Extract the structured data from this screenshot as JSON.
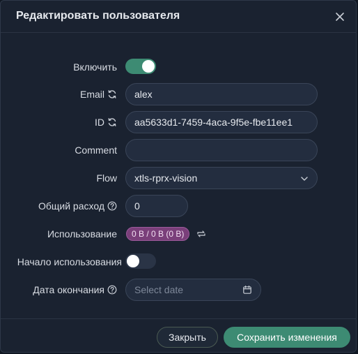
{
  "dialog": {
    "title": "Редактировать пользователя"
  },
  "form": {
    "enable_label": "Включить",
    "enable_on": true,
    "email_label": "Email",
    "email_value": "alex",
    "id_label": "ID",
    "id_value": "aa5633d1-7459-4aca-9f5e-fbe11ee1",
    "comment_label": "Comment",
    "comment_value": "",
    "flow_label": "Flow",
    "flow_value": "xtls-rprx-vision",
    "total_label": "Общий расход",
    "total_value": "0",
    "usage_label": "Использование",
    "usage_value": "0 B / 0 B (0 B)",
    "start_label": "Начало использования",
    "start_on": false,
    "expiry_label": "Дата окончания",
    "expiry_placeholder": "Select date"
  },
  "footer": {
    "close_label": "Закрыть",
    "save_label": "Сохранить изменения"
  },
  "colors": {
    "accent": "#3d8b73",
    "usage_badge": "#7a3f7a",
    "background": "#1a2230"
  },
  "icons": [
    "close-icon",
    "refresh-icon",
    "help-icon",
    "chevron-down-icon",
    "sync-icon",
    "calendar-icon"
  ]
}
